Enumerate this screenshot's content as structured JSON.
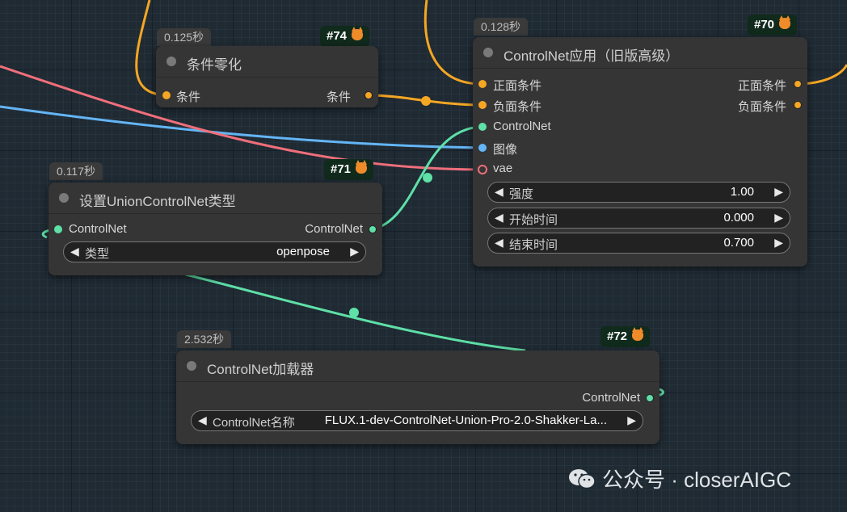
{
  "colors": {
    "conditioning": "#f5a623",
    "controlnet": "#5ee0a7",
    "image": "#64b5f6",
    "vae": "#ef6f7b",
    "node_bg": "#353535"
  },
  "nodes": {
    "zero": {
      "timing": "0.125秒",
      "badge": "#74",
      "title": "条件零化",
      "input": "条件",
      "output": "条件"
    },
    "apply": {
      "timing": "0.128秒",
      "badge": "#70",
      "title": "ControlNet应用（旧版高级）",
      "inputs": [
        "正面条件",
        "负面条件",
        "ControlNet",
        "图像",
        "vae"
      ],
      "outputs": [
        "正面条件",
        "负面条件"
      ],
      "widgets": [
        {
          "label": "强度",
          "value": "1.00"
        },
        {
          "label": "开始时间",
          "value": "0.000"
        },
        {
          "label": "结束时间",
          "value": "0.700"
        }
      ]
    },
    "union": {
      "timing": "0.117秒",
      "badge": "#71",
      "title": "设置UnionControlNet类型",
      "input": "ControlNet",
      "output": "ControlNet",
      "widget": {
        "label": "类型",
        "value": "openpose"
      }
    },
    "loader": {
      "timing": "2.532秒",
      "badge": "#72",
      "title": "ControlNet加载器",
      "output": "ControlNet",
      "widget": {
        "label": "ControlNet名称",
        "value": "FLUX.1-dev-ControlNet-Union-Pro-2.0-Shakker-La..."
      }
    }
  },
  "watermark": {
    "icon": "wechat-icon",
    "text": "公众号 · closerAIGC"
  }
}
